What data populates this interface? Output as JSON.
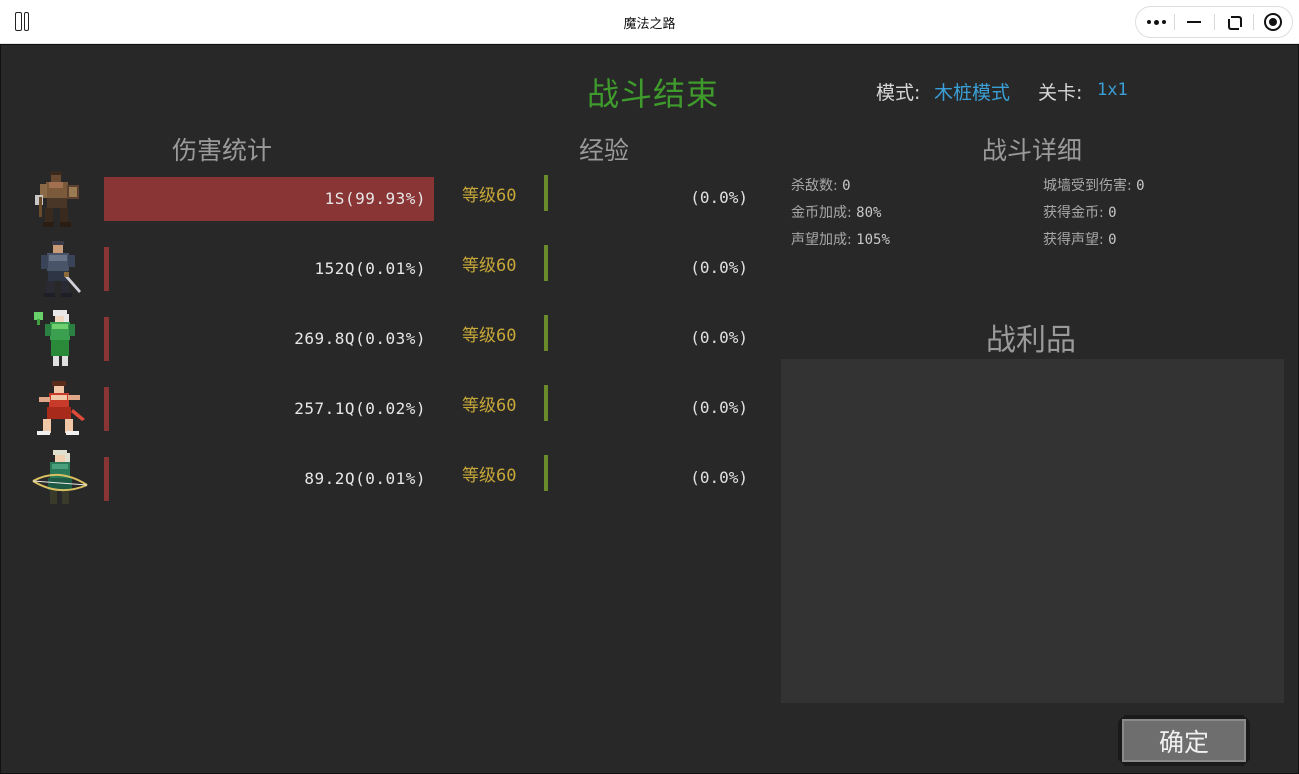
{
  "window": {
    "title": "魔法之路"
  },
  "header": {
    "title": "战斗结束",
    "mode_label": "模式:",
    "mode_value": "木桩模式",
    "level_label": "关卡:",
    "level_value": "1x1"
  },
  "sections": {
    "damage": "伤害统计",
    "experience": "经验",
    "details": "战斗详细",
    "loot": "战利品"
  },
  "heroes": [
    {
      "portrait": "warrior-portrait-icon",
      "damage_text": "1S(99.93%)",
      "damage_share": 0.9993,
      "level_text": "等级60",
      "exp_text": "(0.0%)",
      "exp_progress": 0.0
    },
    {
      "portrait": "swordsman-portrait-icon",
      "damage_text": "152Q(0.01%)",
      "damage_share": 0.0001,
      "level_text": "等级60",
      "exp_text": "(0.0%)",
      "exp_progress": 0.0
    },
    {
      "portrait": "mage-portrait-icon",
      "damage_text": "269.8Q(0.03%)",
      "damage_share": 0.0003,
      "level_text": "等级60",
      "exp_text": "(0.0%)",
      "exp_progress": 0.0
    },
    {
      "portrait": "dancer-portrait-icon",
      "damage_text": "257.1Q(0.02%)",
      "damage_share": 0.0002,
      "level_text": "等级60",
      "exp_text": "(0.0%)",
      "exp_progress": 0.0
    },
    {
      "portrait": "archer-portrait-icon",
      "damage_text": "89.2Q(0.01%)",
      "damage_share": 0.0001,
      "level_text": "等级60",
      "exp_text": "(0.0%)",
      "exp_progress": 0.0
    }
  ],
  "details": {
    "kills_label": "杀敌数:",
    "kills_value": "0",
    "gold_bonus_label": "金币加成:",
    "gold_bonus_value": "80%",
    "fame_bonus_label": "声望加成:",
    "fame_bonus_value": "105%",
    "wall_damage_label": "城墙受到伤害:",
    "wall_damage_value": "0",
    "gold_gained_label": "获得金币:",
    "gold_gained_value": "0",
    "fame_gained_label": "获得声望:",
    "fame_gained_value": "0"
  },
  "colors": {
    "damage_bar": "#8a3535",
    "exp_bar": "#6b8a2a",
    "title_green": "#3f9b2c",
    "mode_blue": "#3a9fd6",
    "level_gold": "#c8a838"
  },
  "buttons": {
    "confirm": "确定"
  }
}
